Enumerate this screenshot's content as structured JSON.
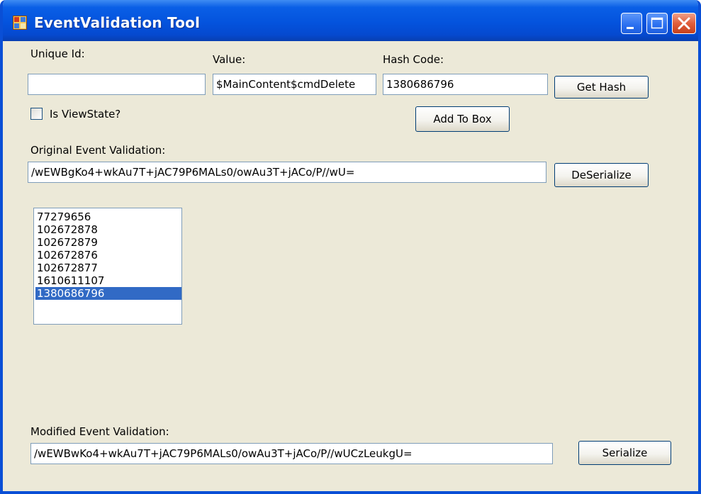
{
  "window": {
    "title": "EventValidation Tool"
  },
  "fields": {
    "unique_id": {
      "label": "Unique Id:",
      "value": ""
    },
    "value": {
      "label": "Value:",
      "value": "$MainContent$cmdDelete"
    },
    "hash_code": {
      "label": "Hash Code:",
      "value": "1380686796"
    }
  },
  "buttons": {
    "get_hash": "Get Hash",
    "add_to_box": "Add To Box",
    "deserialize": "DeSerialize",
    "serialize": "Serialize"
  },
  "checkbox": {
    "label": "Is ViewState?",
    "checked": false
  },
  "original": {
    "label": "Original Event Validation:",
    "value": "/wEWBgKo4+wkAu7T+jAC79P6MALs0/owAu3T+jACo/P//wU="
  },
  "listbox": {
    "items": [
      {
        "text": "77279656"
      },
      {
        "text": "102672878"
      },
      {
        "text": "102672879"
      },
      {
        "text": "102672876"
      },
      {
        "text": "102672877"
      },
      {
        "text": "1610611107"
      },
      {
        "text": "1380686796",
        "selected": true
      }
    ]
  },
  "modified": {
    "label": "Modified Event Validation:",
    "value": "/wEWBwKo4+wkAu7T+jAC79P6MALs0/owAu3T+jACo/P//wUCzLeukgU="
  },
  "colors": {
    "title_bar": "#0453dd",
    "window_bg": "#ece9d8",
    "selection": "#316ac5"
  },
  "icons": [
    "app-icon",
    "minimize-icon",
    "maximize-icon",
    "close-icon"
  ]
}
